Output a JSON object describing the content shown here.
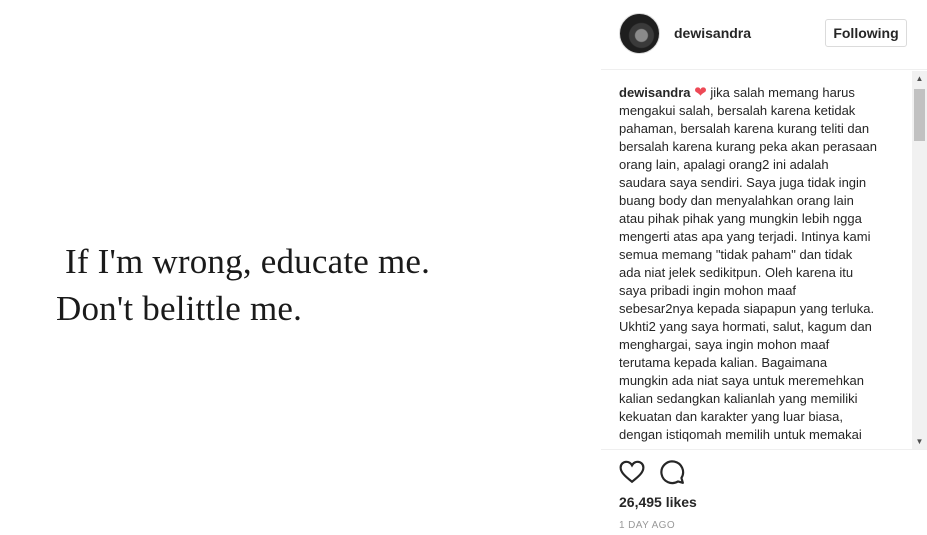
{
  "post": {
    "quote_line1": "If I'm wrong, educate me.",
    "quote_line2": "Don't belittle me."
  },
  "header": {
    "username": "dewisandra",
    "follow_button": "Following"
  },
  "caption": {
    "username": "dewisandra",
    "heart": "❤",
    "lines": [
      "jika salah memang harus",
      "mengakui salah, bersalah karena ketidak",
      "pahaman, bersalah karena kurang teliti dan",
      "bersalah karena kurang peka akan perasaan",
      "orang lain, apalagi orang2 ini adalah",
      "saudara saya sendiri. Saya juga tidak ingin",
      "buang body dan menyalahkan orang lain",
      "atau pihak pihak yang mungkin lebih ngga",
      "mengerti atas apa yang terjadi. Intinya kami",
      "semua memang \"tidak paham\" dan tidak",
      "ada niat jelek sedikitpun. Oleh karena itu",
      "saya pribadi ingin mohon maaf",
      "sebesar2nya kepada siapapun yang terluka.",
      "Ukhti2 yang saya hormati, salut, kagum dan",
      "menghargai, saya ingin mohon maaf",
      "terutama kepada kalian. Bagaimana",
      "mungkin ada niat saya untuk meremehkan",
      "kalian sedangkan kalianlah yang memiliki",
      "kekuatan dan karakter yang luar biasa,",
      "dengan istiqomah memilih untuk memakai"
    ]
  },
  "icons": {
    "like": "heart-outline-icon",
    "comment": "speech-bubble-icon",
    "scroll_up": "▲",
    "scroll_down": "▼"
  },
  "stats": {
    "likes": "26,495 likes",
    "time": "1 DAY AGO"
  },
  "colors": {
    "heart": "#ed4956",
    "border": "#efefef",
    "muted": "#999999"
  }
}
